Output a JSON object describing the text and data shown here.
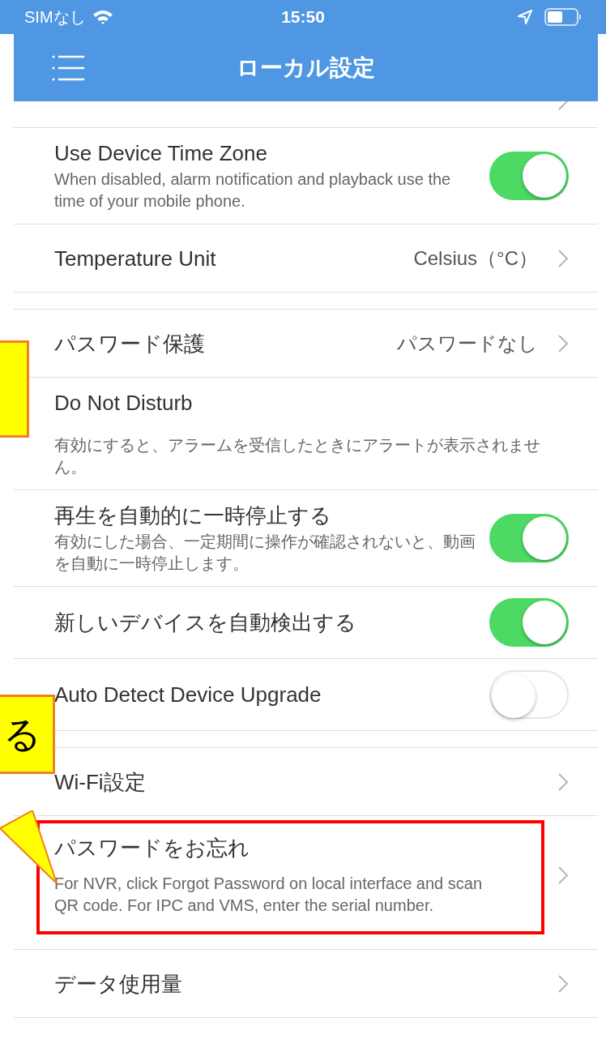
{
  "status_bar": {
    "carrier": "SIMなし",
    "time": "15:50"
  },
  "nav": {
    "title": "ローカル設定"
  },
  "sections": [
    {
      "rows": [
        {
          "kind": "partial"
        },
        {
          "kind": "toggle",
          "title": "Use Device Time Zone",
          "description": "When disabled, alarm notification and playback use the time of your mobile phone.",
          "on": true
        },
        {
          "kind": "nav",
          "title": "Temperature Unit",
          "value": "Celsius（°C）"
        }
      ]
    },
    {
      "rows": [
        {
          "kind": "nav",
          "title": "パスワード保護",
          "value": "パスワードなし"
        },
        {
          "kind": "info",
          "title": "Do Not Disturb",
          "description": "有効にすると、アラームを受信したときにアラートが表示されません。"
        },
        {
          "kind": "toggle",
          "title": "再生を自動的に一時停止する",
          "description": "有効にした場合、一定期間に操作が確認されないと、動画を自動に一時停止します。",
          "on": true
        },
        {
          "kind": "toggle",
          "title": "新しいデバイスを自動検出する",
          "on": true
        },
        {
          "kind": "toggle",
          "title": "Auto Detect Device Upgrade",
          "on": false
        }
      ]
    },
    {
      "rows": [
        {
          "kind": "nav",
          "title": "Wi-Fi設定"
        },
        {
          "kind": "nav",
          "title": "パスワードをお忘れ",
          "description": "For NVR, click Forgot Password on local interface and scan QR code. For IPC and VMS, enter the serial number.",
          "highlighted": true
        },
        {
          "kind": "nav",
          "title": "データ使用量"
        }
      ]
    }
  ],
  "callouts": [
    {
      "kind": "box"
    },
    {
      "kind": "box",
      "text": "る"
    }
  ]
}
